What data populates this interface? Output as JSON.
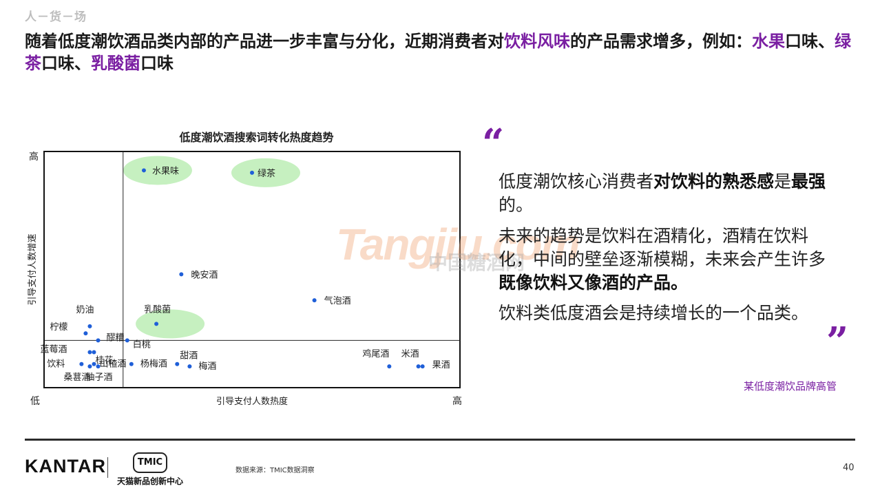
{
  "breadcrumb": "人－货－场",
  "headline": {
    "part1": "随着低度潮饮酒品类内部的产品进一步丰富与分化，近期消费者对",
    "hl1": "饮料风味",
    "part2": "的产品需求增多，例如：",
    "hl2": "水果",
    "part3": "口味、",
    "hl3": "绿茶",
    "part4": "口味、",
    "hl4": "乳酸菌",
    "part5": "口味"
  },
  "watermark": {
    "en": "Tangjiu.com",
    "cn": "中国糖酒网"
  },
  "quote": {
    "open_mark": "“",
    "close_mark": "”",
    "p1_a": "低度潮饮核心消费者",
    "p1_b": "对饮料的熟悉感",
    "p1_c": "是",
    "p1_d": "最强",
    "p1_e": "的。",
    "p2_a": "未来的趋势是饮料在酒精化，酒精在饮料化，中间的壁垒逐渐模糊，未来会产生许多",
    "p2_b": "既像饮料又像酒的产品。",
    "p3": "饮料类低度酒会是持续增长的一个品类。",
    "attribution": "某低度潮饮品牌高管"
  },
  "footer": {
    "kantar": "KANTAR",
    "tmic_badge": "TMIC",
    "tmic_name": "天猫新品创新中心",
    "source": "数据来源：TMIC数据洞察",
    "page": "40"
  },
  "colors": {
    "accent": "#7a1fa2",
    "point": "#1f5fd8",
    "bubble": "#c6f0c0"
  },
  "chart_data": {
    "type": "scatter",
    "title": "低度潮饮酒搜索词转化热度趋势",
    "xlabel": "引导支付人数热度",
    "ylabel": "引导支付人数增速",
    "x_low": "低",
    "x_high": "高",
    "y_high": "高",
    "xlim": [
      0,
      100
    ],
    "ylim": [
      0,
      100
    ],
    "divider": {
      "x": 19,
      "y": 20
    },
    "points": [
      {
        "label": "水果味",
        "x": 24,
        "y": 92,
        "highlight": true
      },
      {
        "label": "绿茶",
        "x": 50,
        "y": 91,
        "highlight": true
      },
      {
        "label": "晚安酒",
        "x": 33,
        "y": 48
      },
      {
        "label": "气泡酒",
        "x": 65,
        "y": 37
      },
      {
        "label": "乳酸菌",
        "x": 27,
        "y": 27,
        "highlight": true
      },
      {
        "label": "奶油",
        "x": 11,
        "y": 26
      },
      {
        "label": "柠檬",
        "x": 10,
        "y": 23
      },
      {
        "label": "醪糟",
        "x": 13,
        "y": 20
      },
      {
        "label": "白桃",
        "x": 20,
        "y": 20
      },
      {
        "label": "蓝莓酒",
        "x": 11,
        "y": 15
      },
      {
        "label": "桂花",
        "x": 12,
        "y": 15
      },
      {
        "label": "饮料",
        "x": 9,
        "y": 10
      },
      {
        "label": "山楂酒",
        "x": 12,
        "y": 10
      },
      {
        "label": "桑葚酒",
        "x": 11,
        "y": 9
      },
      {
        "label": "柚子酒",
        "x": 13,
        "y": 9
      },
      {
        "label": "杨梅酒",
        "x": 21,
        "y": 10
      },
      {
        "label": "甜酒",
        "x": 32,
        "y": 10
      },
      {
        "label": "梅酒",
        "x": 35,
        "y": 9
      },
      {
        "label": "鸡尾酒",
        "x": 83,
        "y": 9
      },
      {
        "label": "米酒",
        "x": 90,
        "y": 9
      },
      {
        "label": "果酒",
        "x": 91,
        "y": 9
      }
    ]
  }
}
